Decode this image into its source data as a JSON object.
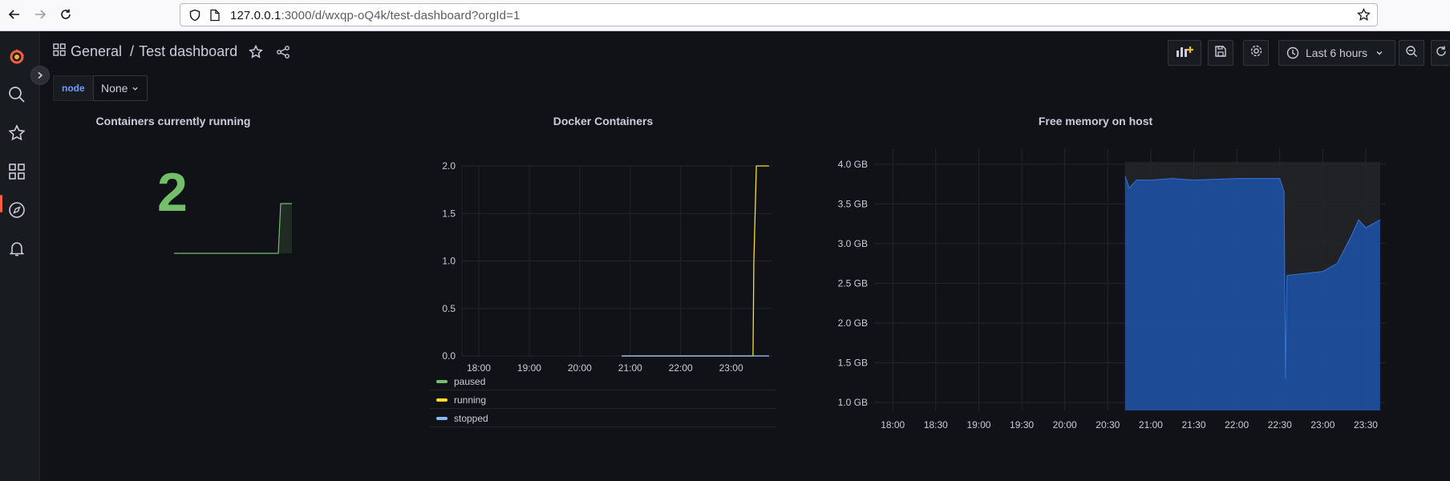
{
  "browser": {
    "url_host": "127.0.0.1",
    "url_rest": ":3000/d/wxqp-oQ4k/test-dashboard?orgId=1"
  },
  "topbar": {
    "breadcrumb_folder": "General",
    "breadcrumb_sep": "/",
    "dashboard_title": "Test dashboard",
    "time_range": "Last 6 hours"
  },
  "variables": {
    "node_label": "node",
    "node_value": "None"
  },
  "icons": {
    "back": "arrow-left-icon",
    "forward": "arrow-right-icon",
    "reload": "reload-icon",
    "shield": "shield-icon",
    "page": "page-icon",
    "bookmark": "star-icon",
    "grafana": "grafana-logo-icon",
    "search": "search-icon",
    "starred": "star-icon",
    "dashboards": "apps-icon",
    "explore": "compass-icon",
    "alerting": "bell-icon",
    "add_panel": "add-panel-icon",
    "save": "save-icon",
    "settings": "gear-icon",
    "clock": "clock-icon",
    "zoom_out": "zoom-out-icon",
    "refresh": "refresh-icon"
  },
  "colors": {
    "green": "#73bf69",
    "yellow": "#fade2a",
    "blue": "#8ab8ff",
    "memory_fill": "#1f4e9b",
    "accent": "#f55f3e"
  },
  "panels": {
    "stat": {
      "title": "Containers currently running",
      "value": "2"
    },
    "docker": {
      "title": "Docker Containers",
      "legend": [
        {
          "name": "paused",
          "color": "#73bf69"
        },
        {
          "name": "running",
          "color": "#fade2a"
        },
        {
          "name": "stopped",
          "color": "#8ab8ff"
        }
      ]
    },
    "memory": {
      "title": "Free memory on host"
    }
  },
  "chart_data": [
    {
      "type": "line",
      "title": "Docker Containers",
      "x_ticks": [
        "18:00",
        "19:00",
        "20:00",
        "21:00",
        "22:00",
        "23:00"
      ],
      "y_ticks": [
        "2.0",
        "1.5",
        "1.0",
        "0.5",
        "0.0"
      ],
      "ylim": [
        0,
        2
      ],
      "grid": true,
      "legend_position": "bottom",
      "series": [
        {
          "name": "paused",
          "color": "#73bf69",
          "points": [
            [
              "20:50",
              0
            ],
            [
              "23:45",
              0
            ]
          ]
        },
        {
          "name": "running",
          "color": "#fade2a",
          "points": [
            [
              "20:50",
              0
            ],
            [
              "23:26",
              0
            ],
            [
              "23:27",
              1
            ],
            [
              "23:30",
              2
            ],
            [
              "23:45",
              2
            ]
          ]
        },
        {
          "name": "stopped",
          "color": "#8ab8ff",
          "points": [
            [
              "20:50",
              0
            ],
            [
              "23:45",
              0
            ]
          ]
        }
      ]
    },
    {
      "type": "area",
      "title": "Free memory on host",
      "x_ticks": [
        "18:00",
        "18:30",
        "19:00",
        "19:30",
        "20:00",
        "20:30",
        "21:00",
        "21:30",
        "22:00",
        "22:30",
        "23:00",
        "23:30"
      ],
      "y_ticks": [
        "4.0 GB",
        "3.5 GB",
        "3.0 GB",
        "2.5 GB",
        "2.0 GB",
        "1.5 GB",
        "1.0 GB"
      ],
      "ylim": [
        0.9,
        4.2
      ],
      "grid": true,
      "series": [
        {
          "name": "free memory",
          "color": "#1f4e9b",
          "points": [
            [
              "20:42",
              3.85
            ],
            [
              "20:45",
              3.7
            ],
            [
              "20:50",
              3.8
            ],
            [
              "21:00",
              3.8
            ],
            [
              "21:15",
              3.82
            ],
            [
              "21:30",
              3.8
            ],
            [
              "22:00",
              3.82
            ],
            [
              "22:30",
              3.82
            ],
            [
              "22:33",
              3.65
            ],
            [
              "22:34",
              1.3
            ],
            [
              "22:35",
              2.6
            ],
            [
              "23:00",
              2.65
            ],
            [
              "23:10",
              2.75
            ],
            [
              "23:20",
              3.1
            ],
            [
              "23:25",
              3.3
            ],
            [
              "23:30",
              3.2
            ],
            [
              "23:40",
              3.3
            ]
          ]
        }
      ]
    },
    {
      "type": "line",
      "title": "Containers currently running",
      "sparkline": true,
      "series": [
        {
          "name": "running",
          "color": "#73bf69",
          "points": [
            [
              "20:50",
              0
            ],
            [
              "23:26",
              0
            ],
            [
              "23:27",
              1
            ],
            [
              "23:30",
              2
            ],
            [
              "23:45",
              2
            ]
          ]
        }
      ]
    }
  ]
}
